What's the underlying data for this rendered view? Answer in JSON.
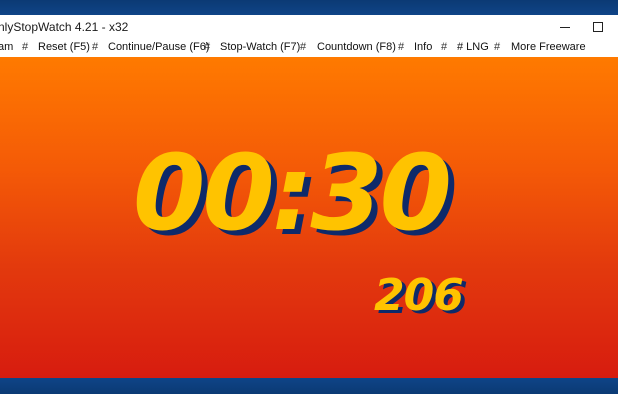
{
  "window": {
    "title": "nlyStopWatch 4.21 - x32"
  },
  "menu": {
    "items": [
      {
        "label": "am"
      },
      {
        "label": "Reset  (F5)"
      },
      {
        "label": "Continue/Pause (F6)"
      },
      {
        "label": "Stop-Watch  (F7)"
      },
      {
        "label": "Countdown  (F8)"
      },
      {
        "label": "Info"
      },
      {
        "label": "# LNG"
      },
      {
        "label": "More Freeware"
      }
    ],
    "separator": "#"
  },
  "display": {
    "time": "00:30",
    "milliseconds": "206"
  },
  "colors": {
    "background_top": "#ff7a00",
    "background_bottom": "#d71c0f",
    "digits": "#ffc300",
    "digit_shadow": "#0e2a6a"
  },
  "icons": {
    "minimize": "minimize-icon",
    "maximize": "maximize-icon"
  }
}
